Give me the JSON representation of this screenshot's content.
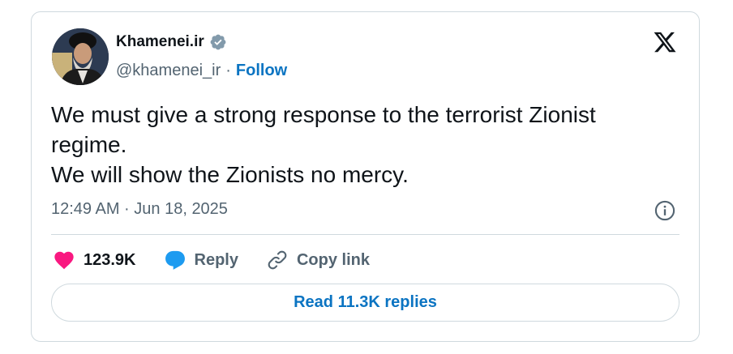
{
  "author": {
    "display_name": "Khamenei.ir",
    "handle": "@khamenei_ir",
    "separator": "·",
    "follow_label": "Follow",
    "verified_color": "#829aab"
  },
  "tweet": {
    "lines": [
      "We must give a strong response to the terrorist Zionist regime.",
      "We will show the Zionists no mercy."
    ],
    "timestamp": "12:49 AM · Jun 18, 2025"
  },
  "actions": {
    "likes": "123.9K",
    "reply_label": "Reply",
    "copy_link_label": "Copy link"
  },
  "read_replies_label": "Read 11.3K replies",
  "icons": {
    "platform": "x-logo-icon",
    "verified": "verified-badge-icon",
    "info": "info-icon",
    "like": "heart-icon",
    "reply": "chat-bubble-icon",
    "copy": "link-icon"
  },
  "colors": {
    "like": "#f91880",
    "reply": "#1d9bf0",
    "link": "#0b74c2",
    "muted": "#536471"
  }
}
